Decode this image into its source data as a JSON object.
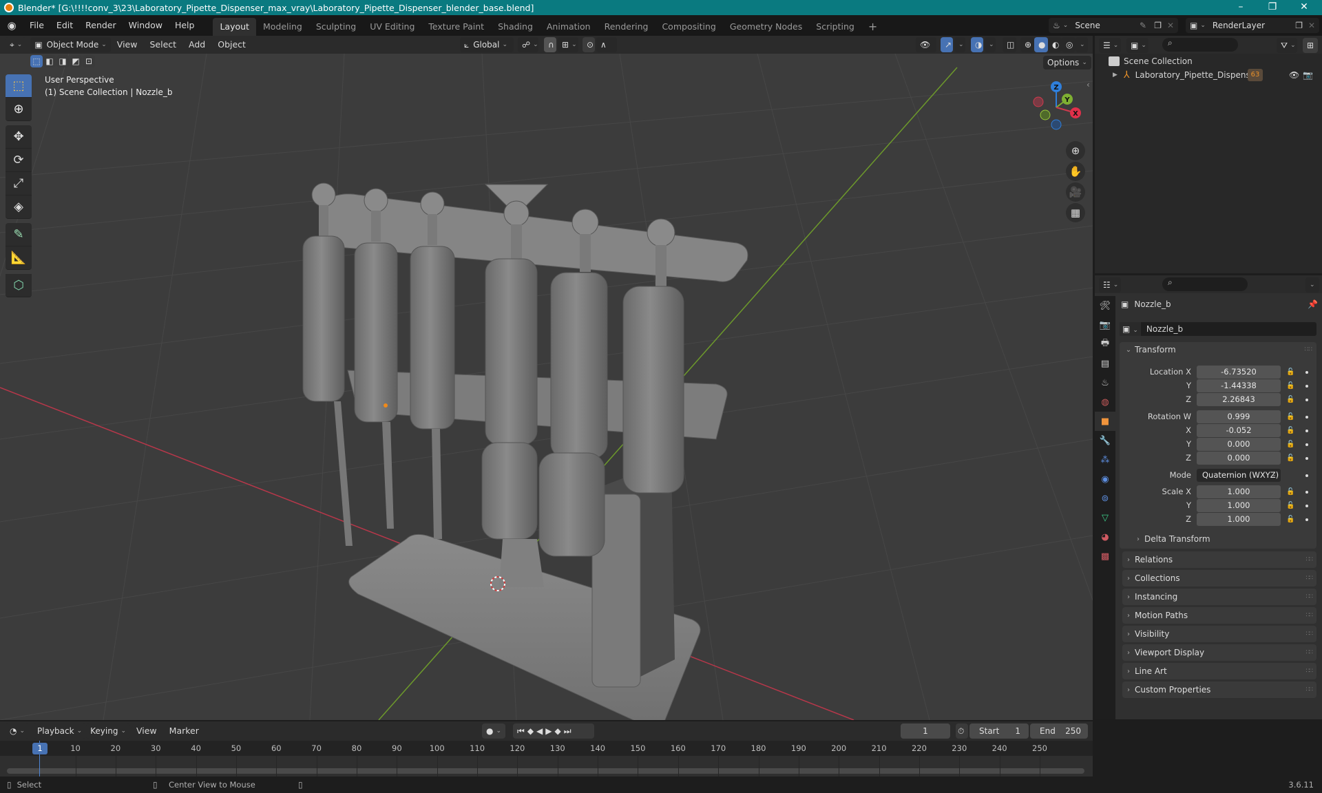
{
  "window": {
    "title": "Blender* [G:\\!!!!conv_3\\23\\Laboratory_Pipette_Dispenser_max_vray\\Laboratory_Pipette_Dispenser_blender_base.blend]",
    "controls": {
      "minimize": "–",
      "maximize": "❐",
      "close": "✕"
    }
  },
  "menubar": {
    "menus": [
      "File",
      "Edit",
      "Render",
      "Window",
      "Help"
    ],
    "workspaces": [
      "Layout",
      "Modeling",
      "Sculpting",
      "UV Editing",
      "Texture Paint",
      "Shading",
      "Animation",
      "Rendering",
      "Compositing",
      "Geometry Nodes",
      "Scripting"
    ],
    "active_workspace": "Layout",
    "add_workspace": "+",
    "scene": "Scene",
    "view_layer": "RenderLayer"
  },
  "viewport_header": {
    "mode": "Object Mode",
    "menus": [
      "View",
      "Select",
      "Add",
      "Object"
    ],
    "transform_orientation": "Global",
    "options_label": "Options"
  },
  "viewport": {
    "view_name": "User Perspective",
    "collection_info": "(1) Scene Collection | Nozzle_b",
    "gizmo_axes": {
      "x": "X",
      "y": "Y",
      "z": "Z"
    },
    "colors": {
      "x_axis": "#d03a4d",
      "y_axis": "#7fb032",
      "z_axis": "#2f7fdb",
      "model": "#7e7e7e",
      "grid_bg": "#3c3c3c"
    }
  },
  "toolbar": {
    "tools": [
      {
        "name": "select-box",
        "glyph": "⬚"
      },
      {
        "name": "cursor",
        "glyph": "⊕"
      },
      {
        "name": "move",
        "glyph": "✥"
      },
      {
        "name": "rotate",
        "glyph": "⟳"
      },
      {
        "name": "scale",
        "glyph": "⤢"
      },
      {
        "name": "transform",
        "glyph": "◈"
      },
      {
        "name": "annotate",
        "glyph": "✎"
      },
      {
        "name": "measure",
        "glyph": "📐"
      },
      {
        "name": "add-cube",
        "glyph": "⬡"
      }
    ]
  },
  "outliner": {
    "root": "Scene Collection",
    "items": [
      {
        "name": "Laboratory_Pipette_Dispenser",
        "badge": "63"
      }
    ]
  },
  "properties": {
    "object_name": "Nozzle_b",
    "datablock_name": "Nozzle_b",
    "transform": {
      "title": "Transform",
      "location": {
        "label": "Location X",
        "x": "-6.73520",
        "y": "-1.44338",
        "z": "2.26843"
      },
      "rotation": {
        "label": "Rotation W",
        "w": "0.999",
        "x": "-0.052",
        "y": "0.000",
        "z": "0.000"
      },
      "mode_label": "Mode",
      "mode": "Quaternion (WXYZ)",
      "scale": {
        "label": "Scale X",
        "x": "1.000",
        "y": "1.000",
        "z": "1.000"
      },
      "axis_labels": {
        "x": "X",
        "y": "Y",
        "z": "Z"
      },
      "delta": "Delta Transform"
    },
    "panels": [
      "Relations",
      "Collections",
      "Instancing",
      "Motion Paths",
      "Visibility",
      "Viewport Display",
      "Line Art",
      "Custom Properties"
    ]
  },
  "timeline": {
    "menus": [
      "Playback",
      "Keying",
      "View",
      "Marker"
    ],
    "current_frame": "1",
    "start_label": "Start",
    "start": "1",
    "end_label": "End",
    "end": "250",
    "ticks": [
      "1",
      "10",
      "20",
      "30",
      "40",
      "50",
      "60",
      "70",
      "80",
      "90",
      "100",
      "110",
      "120",
      "130",
      "140",
      "150",
      "160",
      "170",
      "180",
      "190",
      "200",
      "210",
      "220",
      "230",
      "240",
      "250"
    ]
  },
  "statusbar": {
    "left_action": "Select",
    "middle_action": "Center View to Mouse",
    "version": "3.6.11"
  }
}
